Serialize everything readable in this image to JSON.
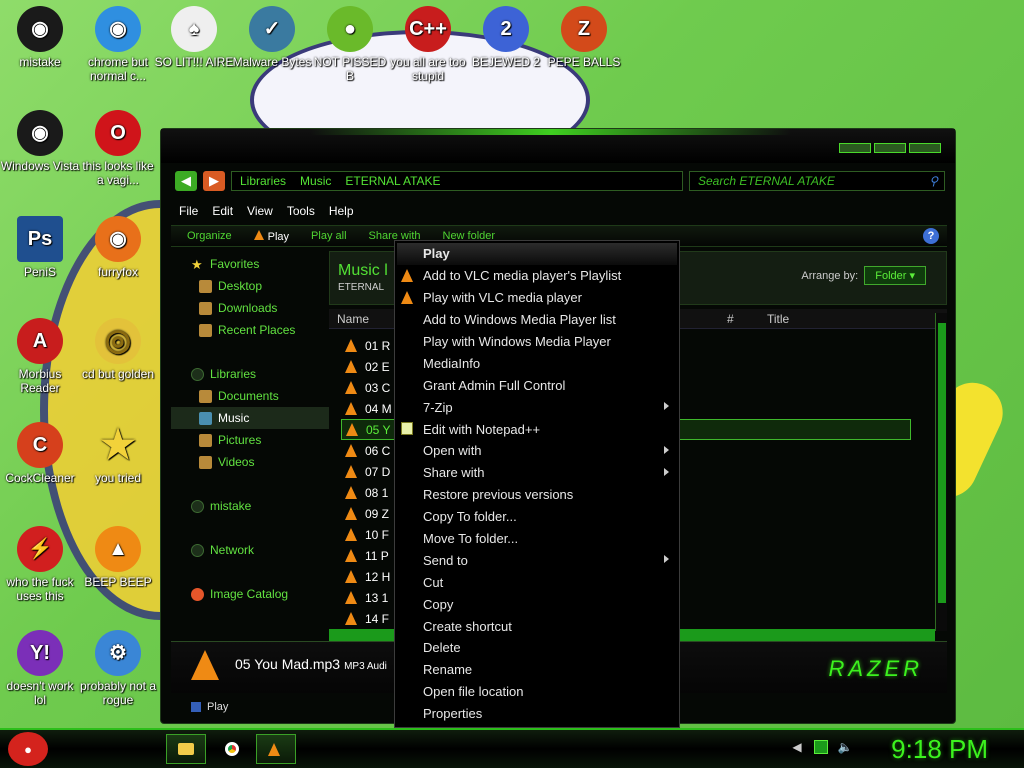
{
  "desktop": {
    "icons": [
      {
        "label": "mistake",
        "icon": "razer-icon",
        "color": "#1a1a1a"
      },
      {
        "label": "chrome but normal c...",
        "icon": "chrome-icon",
        "color": "#2f8fe0"
      },
      {
        "label": "SO LIT!!! AIRE",
        "icon": "solitaire-icon",
        "color": "#efefef"
      },
      {
        "label": "Malware Bytes",
        "icon": "shield-check-icon",
        "color": "#3a7aa0"
      },
      {
        "label": "NOT PISSED B",
        "icon": "angry-birds-icon",
        "color": "#6aba2a"
      },
      {
        "label": "you all are too stupid",
        "icon": "devcpp-icon",
        "color": "#c81d1d"
      },
      {
        "label": "BEJEWED 2",
        "icon": "bejeweled-icon",
        "color": "#3d63d6"
      },
      {
        "label": "PEPE BALLS",
        "icon": "zuma-icon",
        "color": "#d34a1a"
      },
      {
        "label": "Windows Vista",
        "icon": "razer-icon",
        "color": "#1a1a1a"
      },
      {
        "label": "this looks like a vagi...",
        "icon": "opera-icon",
        "color": "#d0141a"
      },
      {
        "label": "PeniS",
        "icon": "photoshop-icon",
        "color": "#1f4f8f"
      },
      {
        "label": "furryfox",
        "icon": "firefox-icon",
        "color": "#e8701a"
      },
      {
        "label": "Morbius Reader",
        "icon": "pdf-icon",
        "color": "#c81d1d"
      },
      {
        "label": "cd but golden",
        "icon": "disc-icon",
        "color": "#e3c23a"
      },
      {
        "label": "CockCleaner",
        "icon": "ccleaner-icon",
        "color": "#d6401c"
      },
      {
        "label": "you tried",
        "icon": "star-icon",
        "color": "#f2d23a"
      },
      {
        "label": "who the fuck uses this",
        "icon": "flash-icon",
        "color": "#d11f1f"
      },
      {
        "label": "BEEP BEEP",
        "icon": "vlc-icon",
        "color": "#ef8a14"
      },
      {
        "label": "doesn't work lol",
        "icon": "yahoo-icon",
        "color": "#7b2fb8"
      },
      {
        "label": "probably not a rogue",
        "icon": "gear-icon",
        "color": "#3a86d6"
      }
    ]
  },
  "window": {
    "address": [
      "Libraries",
      "Music",
      "ETERNAL ATAKE"
    ],
    "search_placeholder": "Search ETERNAL ATAKE",
    "menu": [
      "File",
      "Edit",
      "View",
      "Tools",
      "Help"
    ],
    "toolbar": {
      "organize": "Organize",
      "play": "Play",
      "play_all": "Play all",
      "share_with": "Share with",
      "new_folder": "New folder"
    },
    "nav": {
      "favorites": "Favorites",
      "favorites_items": [
        "Desktop",
        "Downloads",
        "Recent Places"
      ],
      "libraries": "Libraries",
      "libraries_items": [
        "Documents",
        "Music",
        "Pictures",
        "Videos"
      ],
      "mistake": "mistake",
      "network": "Network",
      "image_catalog": "Image Catalog"
    },
    "library": {
      "title": "Music l",
      "subtitle": "ETERNAL",
      "arrange_label": "Arrange by:",
      "arrange_value": "Folder"
    },
    "columns": {
      "name": "Name",
      "number": "#",
      "title": "Title"
    },
    "files": [
      "01 R",
      "02 E",
      "03 C",
      "04 M",
      "05 Y",
      "06 C",
      "07 D",
      "08 1",
      "09 Z",
      "10 F",
      "11 P",
      "12 H",
      "13 1",
      "14 F"
    ],
    "selected_index": 4,
    "details": {
      "filename": "05 You Mad.mp3",
      "filetype": "MP3 Audi",
      "brand": "RAZER"
    },
    "status": "Play"
  },
  "context_menu": {
    "items": [
      {
        "label": "Play",
        "icon": "",
        "submenu": false,
        "default": true
      },
      {
        "label": "Add to VLC media player's Playlist",
        "icon": "vlc-icon",
        "submenu": false,
        "default": false
      },
      {
        "label": "Play with VLC media player",
        "icon": "vlc-icon",
        "submenu": false,
        "default": false
      },
      {
        "label": "Add to Windows Media Player list",
        "icon": "",
        "submenu": false,
        "default": false
      },
      {
        "label": "Play with Windows Media Player",
        "icon": "",
        "submenu": false,
        "default": false
      },
      {
        "label": "MediaInfo",
        "icon": "",
        "submenu": false,
        "default": false
      },
      {
        "label": "Grant Admin Full Control",
        "icon": "",
        "submenu": false,
        "default": false
      },
      {
        "label": "7-Zip",
        "icon": "",
        "submenu": true,
        "default": false
      },
      {
        "label": "Edit with Notepad++",
        "icon": "notepadpp-icon",
        "submenu": false,
        "default": false
      },
      {
        "label": "Open with",
        "icon": "",
        "submenu": true,
        "default": false
      },
      {
        "label": "Share with",
        "icon": "",
        "submenu": true,
        "default": false
      },
      {
        "label": "Restore previous versions",
        "icon": "",
        "submenu": false,
        "default": false
      },
      {
        "label": "Copy To folder...",
        "icon": "",
        "submenu": false,
        "default": false
      },
      {
        "label": "Move To folder...",
        "icon": "",
        "submenu": false,
        "default": false
      },
      {
        "label": "Send to",
        "icon": "",
        "submenu": true,
        "default": false
      },
      {
        "label": "Cut",
        "icon": "",
        "submenu": false,
        "default": false
      },
      {
        "label": "Copy",
        "icon": "",
        "submenu": false,
        "default": false
      },
      {
        "label": "Create shortcut",
        "icon": "",
        "submenu": false,
        "default": false
      },
      {
        "label": "Delete",
        "icon": "",
        "submenu": false,
        "default": false
      },
      {
        "label": "Rename",
        "icon": "",
        "submenu": false,
        "default": false
      },
      {
        "label": "Open file location",
        "icon": "",
        "submenu": false,
        "default": false
      },
      {
        "label": "Properties",
        "icon": "",
        "submenu": false,
        "default": false
      }
    ]
  },
  "taskbar": {
    "clock": "9:18 PM",
    "start_icon": "angry-bird-icon",
    "pinned": [
      "explorer-icon",
      "chrome-icon",
      "vlc-icon"
    ]
  },
  "colors": {
    "accent": "#3cf21e",
    "vlc": "#ef8a14"
  }
}
